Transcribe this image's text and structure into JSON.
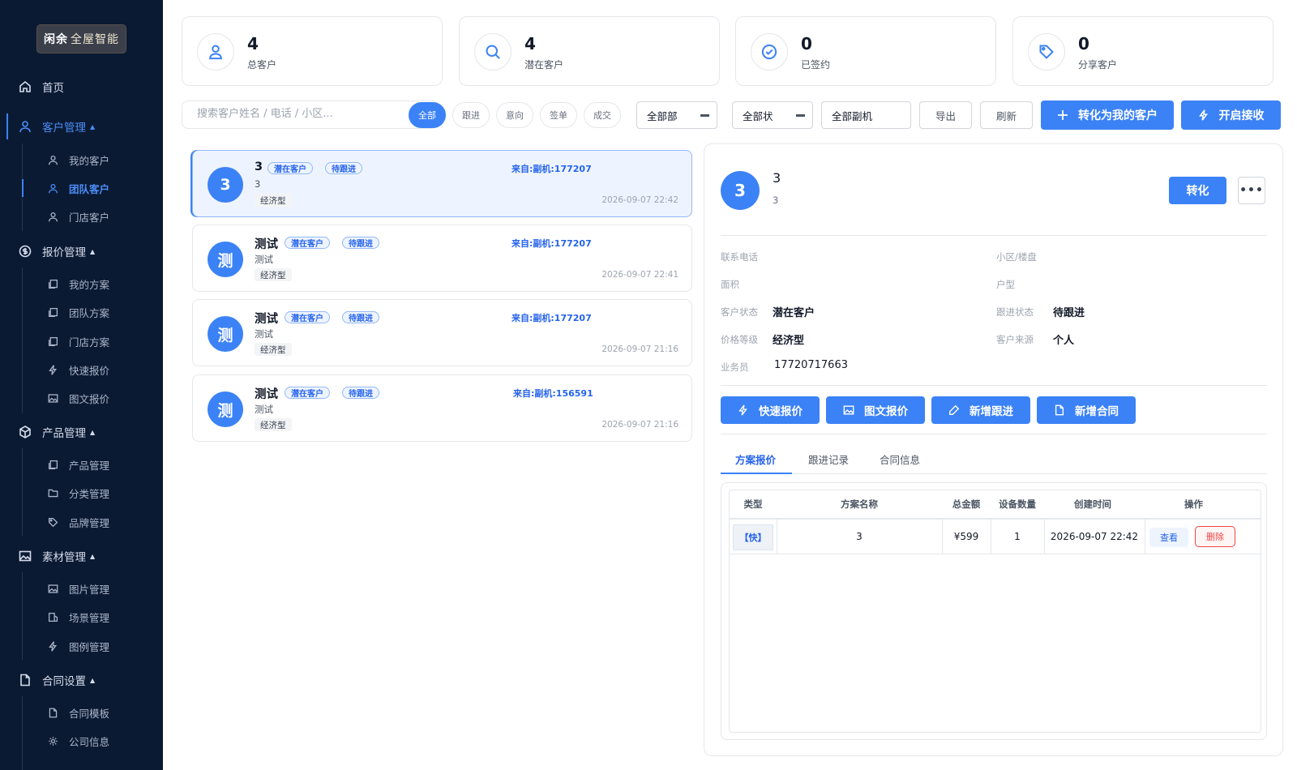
{
  "brand": {
    "logo_mark": "闲余",
    "logo_text": "全屋智能"
  },
  "nav": {
    "home": "首页",
    "customer": {
      "label": "客户管理",
      "items": [
        "我的客户",
        "团队客户",
        "门店客户"
      ]
    },
    "quote": {
      "label": "报价管理",
      "items": [
        "我的方案",
        "团队方案",
        "门店方案",
        "快速报价",
        "图文报价"
      ]
    },
    "product": {
      "label": "产品管理",
      "items": [
        "产品管理",
        "分类管理",
        "品牌管理"
      ]
    },
    "material": {
      "label": "素材管理",
      "items": [
        "图片管理",
        "场景管理",
        "图例管理"
      ]
    },
    "contract": {
      "label": "合同设置",
      "items": [
        "合同模板",
        "公司信息"
      ]
    },
    "caret": "▲"
  },
  "stats": [
    {
      "num": "4",
      "label": "总客户",
      "icon": "user-icon"
    },
    {
      "num": "4",
      "label": "潜在客户",
      "icon": "search-icon"
    },
    {
      "num": "0",
      "label": "已签约",
      "icon": "check-circle-icon"
    },
    {
      "num": "0",
      "label": "分享客户",
      "icon": "tag-icon"
    }
  ],
  "toolbar": {
    "search_placeholder": "搜索客户姓名 / 电话 / 小区...",
    "pills": [
      "全部",
      "跟进",
      "意向",
      "签单",
      "成交"
    ],
    "select_dept": "全部部",
    "select_status": "全部状",
    "select_source": "全部副机",
    "export": "导出",
    "refresh": "刷新",
    "convert_mine": "转化为我的客户",
    "start_receive": "开启接收"
  },
  "customers": [
    {
      "avatar": "3",
      "name": "3",
      "sub": "3",
      "tags": [
        "潜在客户",
        "待跟进"
      ],
      "level": "经济型",
      "source": "来自:副机:177207",
      "time": "2026-09-07 22:42"
    },
    {
      "avatar": "测",
      "name": "测试",
      "sub": "测试",
      "tags": [
        "潜在客户",
        "待跟进"
      ],
      "level": "经济型",
      "source": "来自:副机:177207",
      "time": "2026-09-07 22:41"
    },
    {
      "avatar": "测",
      "name": "测试",
      "sub": "测试",
      "tags": [
        "潜在客户",
        "待跟进"
      ],
      "level": "经济型",
      "source": "来自:副机:177207",
      "time": "2026-09-07 21:16"
    },
    {
      "avatar": "测",
      "name": "测试",
      "sub": "测试",
      "tags": [
        "潜在客户",
        "待跟进"
      ],
      "level": "经济型",
      "source": "来自:副机:156591",
      "time": "2026-09-07 21:16"
    }
  ],
  "detail": {
    "avatar": "3",
    "name": "3",
    "sub": "3",
    "convert": "转化",
    "more": "•••",
    "fields": {
      "phone_label": "联系电话",
      "community_label": "小区/楼盘",
      "area_label": "面积",
      "layout_label": "户型",
      "status_label": "客户状态",
      "status_value": "潜在客户",
      "follow_label": "跟进状态",
      "follow_value": "待跟进",
      "price_label": "价格等级",
      "price_value": "经济型",
      "source_label": "客户来源",
      "source_value": "个人",
      "salesman_label": "业务员",
      "salesman_value": "17720717663"
    },
    "actions": [
      "快速报价",
      "图文报价",
      "新增跟进",
      "新增合同"
    ],
    "tabs": [
      "方案报价",
      "跟进记录",
      "合同信息"
    ],
    "table": {
      "headers": [
        "类型",
        "方案名称",
        "总金额",
        "设备数量",
        "创建时间",
        "操作"
      ],
      "rows": [
        {
          "type": "【快】",
          "name": "3",
          "amount": "¥599",
          "count": "1",
          "created": "2026-09-07 22:42",
          "view": "查看",
          "delete": "删除"
        }
      ]
    }
  }
}
